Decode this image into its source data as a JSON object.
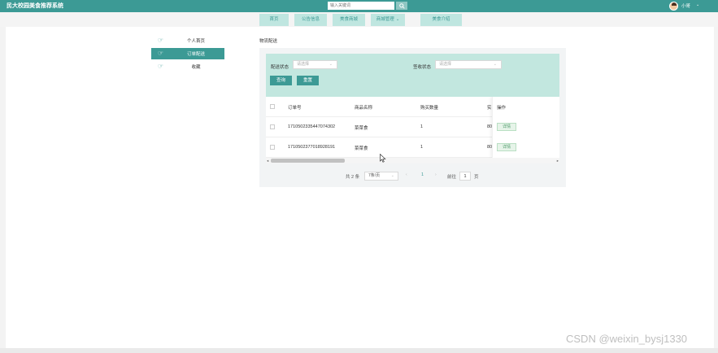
{
  "app": {
    "title": "民大校园美食推荐系统"
  },
  "search": {
    "placeholder": "输入关键词",
    "icon": "search-icon"
  },
  "user": {
    "name": "小哥",
    "caret": "⌄",
    "avatar_icon": "avatar-icon"
  },
  "nav": {
    "items": [
      {
        "label": "首页"
      },
      {
        "label": "公告信息"
      },
      {
        "label": "美食商城"
      },
      {
        "label": "商城管理",
        "caret": "⌄"
      },
      {
        "label": "美食介绍"
      }
    ]
  },
  "sidebar": {
    "items": [
      {
        "label": "个人首页",
        "icon": "pointing-hand-icon",
        "active": false
      },
      {
        "label": "订单配送",
        "icon": "pointing-hand-icon",
        "active": true
      },
      {
        "label": "收藏",
        "icon": "pointing-hand-icon",
        "active": false
      }
    ]
  },
  "breadcrumb": "物流配送",
  "filter": {
    "delivery_status_label": "配送状态",
    "delivery_status_placeholder": "请选择",
    "receipt_status_label": "签收状态",
    "receipt_status_placeholder": "请选择",
    "query_button": "查询",
    "reset_button": "重置",
    "caret": "⌄"
  },
  "table": {
    "columns": [
      "订单号",
      "商品名称",
      "购买数量",
      "实",
      "操作"
    ],
    "rows": [
      {
        "order_no": "1710502335447074302",
        "product": "菜菜食",
        "quantity": "1",
        "amount": "80",
        "action": "详情"
      },
      {
        "order_no": "1710502377018928191",
        "product": "菜菜食",
        "quantity": "1",
        "amount": "80",
        "action": "详情"
      }
    ],
    "scroll_left": "◂",
    "scroll_right": "▸"
  },
  "pagination": {
    "total": "共 2 条",
    "page_size": "7条/页",
    "prev": "‹",
    "current": "1",
    "next": "›",
    "goto_label": "前往",
    "goto_value": "1",
    "page_unit": "页",
    "caret": "⌄"
  },
  "watermark": "CSDN @weixin_bysj1330",
  "colors": {
    "accent": "#3c9a95",
    "filter_bg": "#c2e7df",
    "nav_item_bg": "#bfe6e0"
  }
}
